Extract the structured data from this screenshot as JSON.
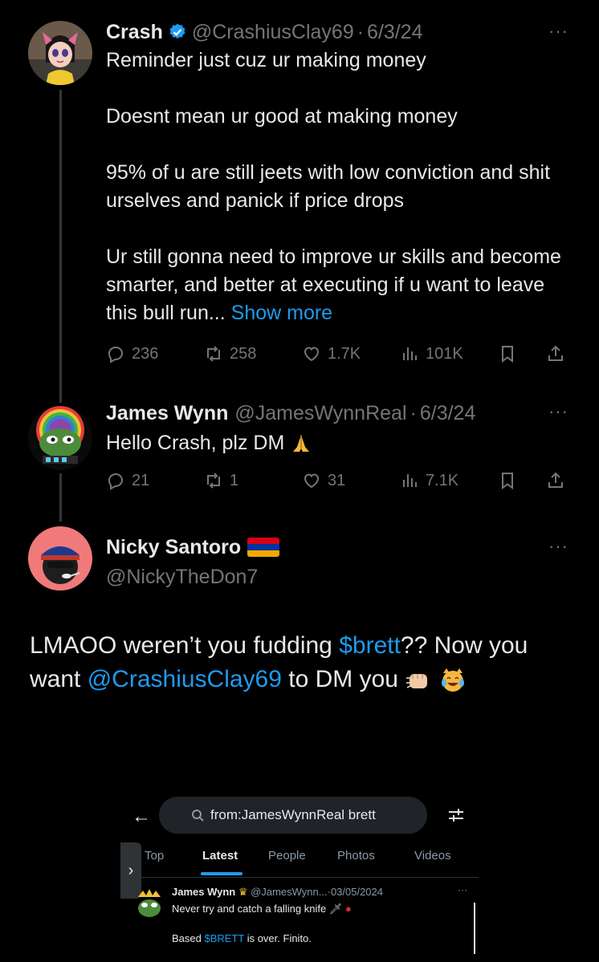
{
  "tweets": [
    {
      "name": "Crash",
      "handle": "@CrashiusClay69",
      "sep": "·",
      "date": "6/3/24",
      "more": "···",
      "paragraphs": [
        "Reminder just cuz ur making money",
        "Doesnt mean ur good at making money",
        "95% of u are still jeets with low conviction and shit urselves and panick if price drops",
        "Ur still gonna need to improve ur skills and become smarter, and better at executing if u want to leave this bull run..."
      ],
      "show_more": "Show more",
      "stats": {
        "replies": "236",
        "reposts": "258",
        "likes": "1.7K",
        "views": "101K"
      }
    },
    {
      "name": "James Wynn",
      "handle": "@JamesWynnReal",
      "sep": "·",
      "date": "6/3/24",
      "more": "···",
      "text": "Hello Crash, plz DM",
      "stats": {
        "replies": "21",
        "reposts": "1",
        "likes": "31",
        "views": "7.1K"
      }
    }
  ],
  "reply": {
    "name": "Nicky Santoro",
    "handle": "@NickyTheDon7",
    "more": "···",
    "text_1": "LMAOO weren’t you fudding ",
    "cashtag": "$brett",
    "text_2": "?? Now you want ",
    "mention": "@CrashiusClay69",
    "text_3": " to DM you"
  },
  "embedded": {
    "back": "←",
    "search_value": "from:JamesWynnReal brett",
    "side_handle": "›",
    "tabs": [
      "Top",
      "Latest",
      "People",
      "Photos",
      "Videos"
    ],
    "active_tab": "Latest",
    "tweet": {
      "name": "James Wynn",
      "handle": "@JamesWynn...",
      "sep": "·",
      "date": "03/05/2024",
      "more": "···",
      "line_1": "Never try and catch a falling knife",
      "line_2a": "Based ",
      "cashtag": "$BRETT",
      "line_2b": " is over. Finito."
    }
  },
  "colors": {
    "background": "#000000",
    "text": "#e7e9ea",
    "secondary": "#71767b",
    "link": "#1d9bf0",
    "verified": "#1d9bf0"
  }
}
